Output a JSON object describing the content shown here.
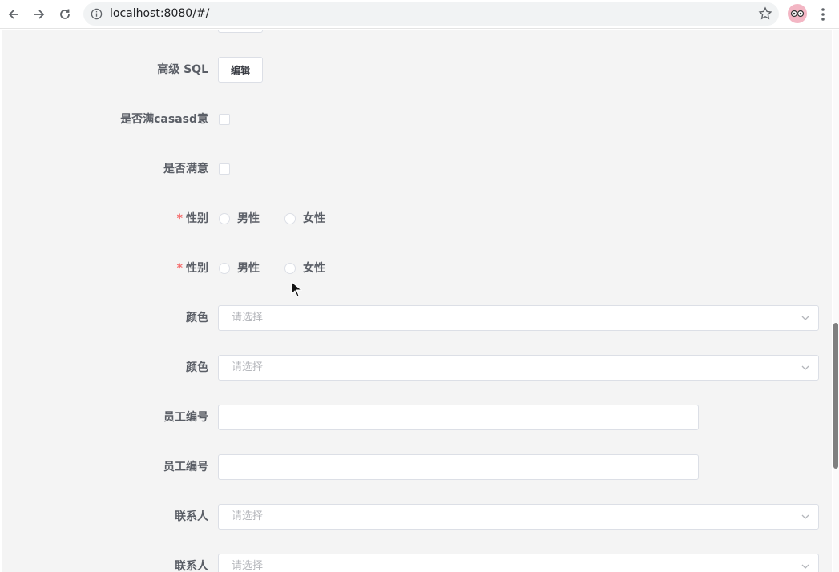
{
  "browser": {
    "url": "localhost:8080/#/"
  },
  "form": {
    "advanced_sql": {
      "label": "高级 SQL",
      "button": "编辑"
    },
    "satisfied_1": {
      "label": "是否满casasd意"
    },
    "satisfied_2": {
      "label": "是否满意"
    },
    "gender_1": {
      "required_mark": "*",
      "label": "性别",
      "options": [
        "男性",
        "女性"
      ]
    },
    "gender_2": {
      "required_mark": "*",
      "label": "性别",
      "options": [
        "男性",
        "女性"
      ]
    },
    "color_1": {
      "label": "颜色",
      "placeholder": "请选择"
    },
    "color_2": {
      "label": "颜色",
      "placeholder": "请选择"
    },
    "employee_id_1": {
      "label": "员工编号",
      "value": ""
    },
    "employee_id_2": {
      "label": "员工编号",
      "value": ""
    },
    "contact_1": {
      "label": "联系人",
      "placeholder": "请选择"
    },
    "contact_2": {
      "label": "联系人",
      "placeholder": "请选择"
    }
  },
  "colors": {
    "required": "#f56c6c",
    "label": "#5a5e66",
    "border": "#dcdfe6",
    "background": "#f4f4f4",
    "placeholder": "#b4b6bb"
  }
}
